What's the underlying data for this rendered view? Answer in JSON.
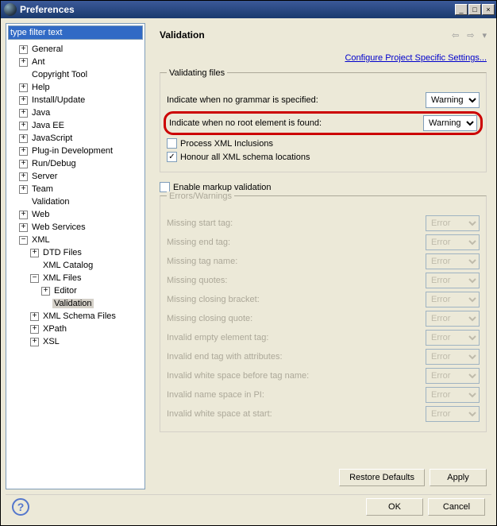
{
  "window": {
    "title": "Preferences"
  },
  "filter": {
    "placeholder": "type filter text"
  },
  "tree": {
    "items": [
      {
        "label": "General",
        "depth": 0,
        "toggle": "+"
      },
      {
        "label": "Ant",
        "depth": 0,
        "toggle": "+"
      },
      {
        "label": "Copyright Tool",
        "depth": 0,
        "toggle": ""
      },
      {
        "label": "Help",
        "depth": 0,
        "toggle": "+"
      },
      {
        "label": "Install/Update",
        "depth": 0,
        "toggle": "+"
      },
      {
        "label": "Java",
        "depth": 0,
        "toggle": "+"
      },
      {
        "label": "Java EE",
        "depth": 0,
        "toggle": "+"
      },
      {
        "label": "JavaScript",
        "depth": 0,
        "toggle": "+"
      },
      {
        "label": "Plug-in Development",
        "depth": 0,
        "toggle": "+"
      },
      {
        "label": "Run/Debug",
        "depth": 0,
        "toggle": "+"
      },
      {
        "label": "Server",
        "depth": 0,
        "toggle": "+"
      },
      {
        "label": "Team",
        "depth": 0,
        "toggle": "+"
      },
      {
        "label": "Validation",
        "depth": 0,
        "toggle": ""
      },
      {
        "label": "Web",
        "depth": 0,
        "toggle": "+"
      },
      {
        "label": "Web Services",
        "depth": 0,
        "toggle": "+"
      },
      {
        "label": "XML",
        "depth": 0,
        "toggle": "−"
      },
      {
        "label": "DTD Files",
        "depth": 1,
        "toggle": "+"
      },
      {
        "label": "XML Catalog",
        "depth": 1,
        "toggle": ""
      },
      {
        "label": "XML Files",
        "depth": 1,
        "toggle": "−"
      },
      {
        "label": "Editor",
        "depth": 2,
        "toggle": "+"
      },
      {
        "label": "Validation",
        "depth": 2,
        "toggle": "",
        "selected": true
      },
      {
        "label": "XML Schema Files",
        "depth": 1,
        "toggle": "+"
      },
      {
        "label": "XPath",
        "depth": 1,
        "toggle": "+"
      },
      {
        "label": "XSL",
        "depth": 1,
        "toggle": "+"
      }
    ]
  },
  "page": {
    "title": "Validation",
    "config_link": "Configure Project Specific Settings...",
    "validating": {
      "legend": "Validating files",
      "no_grammar": {
        "label": "Indicate when no grammar is specified:",
        "value": "Warning"
      },
      "no_root": {
        "label": "Indicate when no root element is found:",
        "value": "Warning"
      },
      "process_xml": "Process XML Inclusions",
      "honour_schema": "Honour all XML schema locations"
    },
    "enable_markup": "Enable markup validation",
    "errors": {
      "legend": "Errors/Warnings",
      "rows": [
        {
          "label": "Missing start tag:",
          "value": "Error"
        },
        {
          "label": "Missing end tag:",
          "value": "Error"
        },
        {
          "label": "Missing tag name:",
          "value": "Error"
        },
        {
          "label": "Missing quotes:",
          "value": "Error"
        },
        {
          "label": "Missing closing bracket:",
          "value": "Error"
        },
        {
          "label": "Missing closing quote:",
          "value": "Error"
        },
        {
          "label": "Invalid empty element tag:",
          "value": "Error"
        },
        {
          "label": "Invalid end tag with attributes:",
          "value": "Error"
        },
        {
          "label": "Invalid white space before tag name:",
          "value": "Error"
        },
        {
          "label": "Invalid name space in PI:",
          "value": "Error"
        },
        {
          "label": "Invalid white space at start:",
          "value": "Error"
        }
      ]
    },
    "restore": "Restore Defaults",
    "apply": "Apply"
  },
  "dialog": {
    "ok": "OK",
    "cancel": "Cancel"
  }
}
